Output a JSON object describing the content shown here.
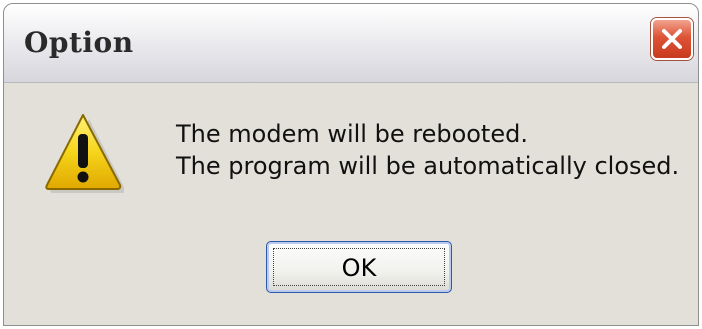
{
  "window": {
    "title": "Option",
    "close_icon": "close-x-icon"
  },
  "dialog": {
    "icon": "warning-icon",
    "message_lines": [
      "The modem will be rebooted.",
      "The program will be automatically closed."
    ],
    "ok_label": "OK"
  },
  "colors": {
    "titlebar": "#e4e4e9",
    "close_button": "#dd5436",
    "dialog_body": "#e2e0d8",
    "warning": "#f6d51b"
  }
}
